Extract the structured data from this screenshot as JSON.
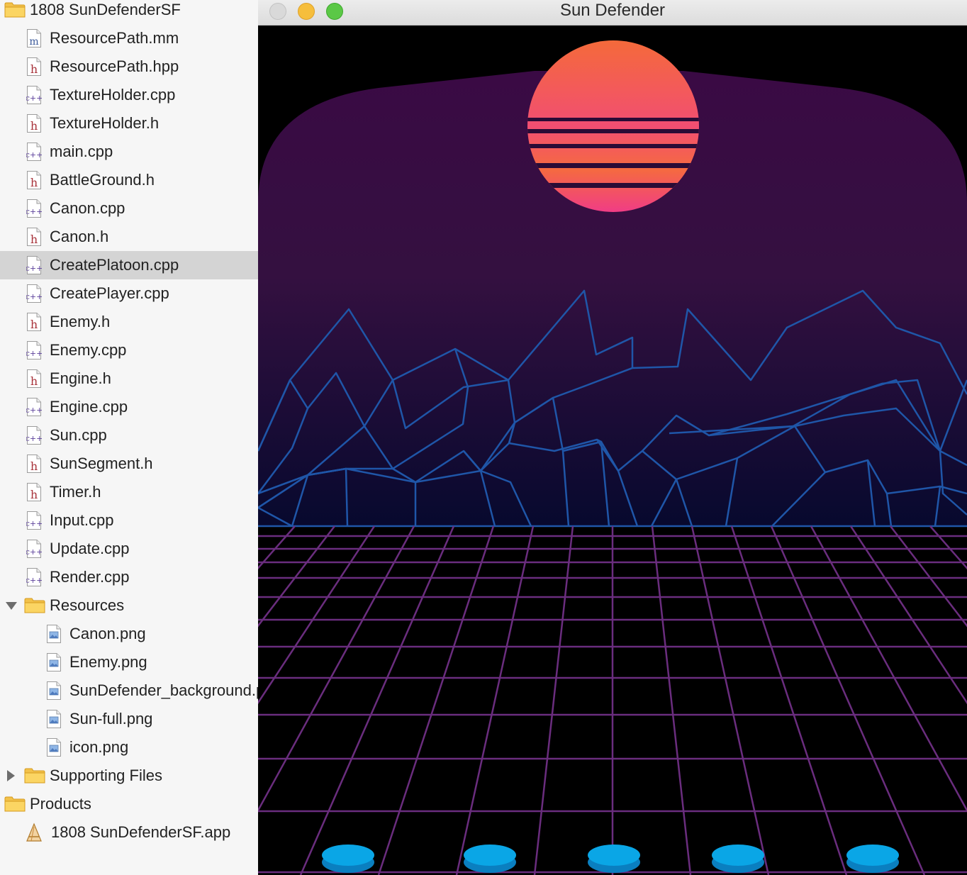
{
  "navigator": {
    "project": "1808 SunDefenderSF",
    "files": [
      {
        "name": "ResourcePath.mm",
        "type": "m"
      },
      {
        "name": "ResourcePath.hpp",
        "type": "h"
      },
      {
        "name": "TextureHolder.cpp",
        "type": "cpp"
      },
      {
        "name": "TextureHolder.h",
        "type": "h"
      },
      {
        "name": "main.cpp",
        "type": "cpp"
      },
      {
        "name": "BattleGround.h",
        "type": "h"
      },
      {
        "name": "Canon.cpp",
        "type": "cpp"
      },
      {
        "name": "Canon.h",
        "type": "h"
      },
      {
        "name": "CreatePlatoon.cpp",
        "type": "cpp",
        "selected": true
      },
      {
        "name": "CreatePlayer.cpp",
        "type": "cpp"
      },
      {
        "name": "Enemy.h",
        "type": "h"
      },
      {
        "name": "Enemy.cpp",
        "type": "cpp"
      },
      {
        "name": "Engine.h",
        "type": "h"
      },
      {
        "name": "Engine.cpp",
        "type": "cpp"
      },
      {
        "name": "Sun.cpp",
        "type": "cpp"
      },
      {
        "name": "SunSegment.h",
        "type": "h"
      },
      {
        "name": "Timer.h",
        "type": "h"
      },
      {
        "name": "Input.cpp",
        "type": "cpp"
      },
      {
        "name": "Update.cpp",
        "type": "cpp"
      },
      {
        "name": "Render.cpp",
        "type": "cpp"
      }
    ],
    "resources_group": "Resources",
    "resources": [
      {
        "name": "Canon.png",
        "type": "image"
      },
      {
        "name": "Enemy.png",
        "type": "image"
      },
      {
        "name": "SunDefender_background.png",
        "type": "image"
      },
      {
        "name": "Sun-full.png",
        "type": "image"
      },
      {
        "name": "icon.png",
        "type": "image"
      }
    ],
    "supporting_group": "Supporting Files",
    "products_group": "Products",
    "product_app": "1808 SunDefenderSF.app"
  },
  "window": {
    "title": "Sun Defender",
    "buttons": {
      "close": "close-button",
      "minimize": "minimize-button",
      "zoom": "zoom-button"
    }
  },
  "game": {
    "colors": {
      "sky_top": "#3a0a44",
      "sky_bottom": "#07092e",
      "mountain_line": "#1f56a8",
      "grid_line": "#6a2d7e",
      "sun_top": "#f46a3a",
      "sun_bottom": "#f03c86",
      "cannon": "#0aa6e6",
      "cannon_rim": "#0a7fc0"
    },
    "cannon_count": 5
  }
}
